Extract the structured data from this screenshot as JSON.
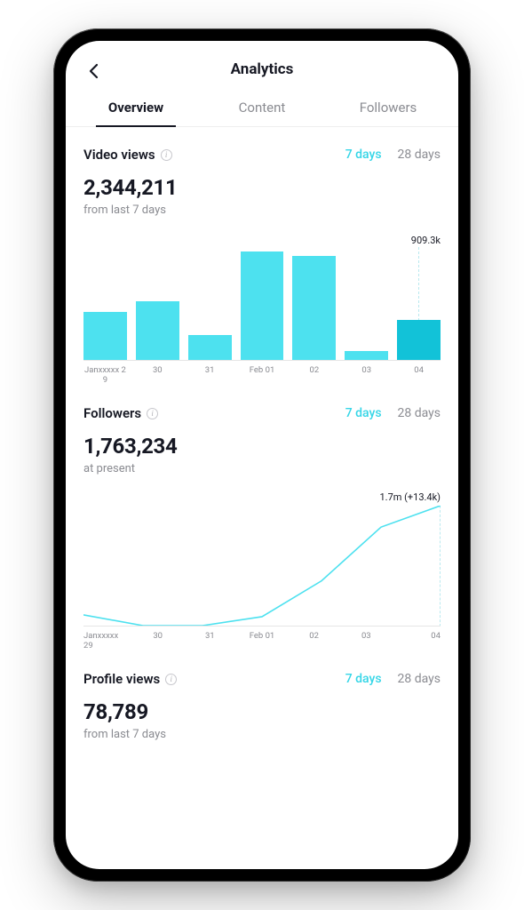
{
  "header": {
    "title": "Analytics"
  },
  "tabs": [
    {
      "label": "Overview",
      "active": true
    },
    {
      "label": "Content",
      "active": false
    },
    {
      "label": "Followers",
      "active": false
    }
  ],
  "range_options": {
    "seven": "7 days",
    "twenty_eight": "28 days"
  },
  "video_views": {
    "title": "Video views",
    "value": "2,344,211",
    "sub": "from last 7 days",
    "annotation": "909.3k"
  },
  "followers": {
    "title": "Followers",
    "value": "1,763,234",
    "sub": "at present",
    "annotation": "1.7m (+13.4k)"
  },
  "profile_views": {
    "title": "Profile views",
    "value": "78,789",
    "sub": "from last 7 days"
  },
  "chart_data": [
    {
      "type": "bar",
      "title": "Video views",
      "categories": [
        "Janxxxxx 29",
        "30",
        "31",
        "Feb 01",
        "02",
        "03",
        "04"
      ],
      "values": [
        390,
        470,
        200,
        875,
        840,
        70,
        320
      ],
      "ylim": [
        0,
        909.3
      ],
      "unit": "k",
      "annotation": "909.3k",
      "highlight_index": 6
    },
    {
      "type": "line",
      "title": "Followers",
      "categories": [
        "Janxxxxx 29",
        "30",
        "31",
        "Feb 01",
        "02",
        "03",
        "04"
      ],
      "values": [
        1.6878,
        1.6866,
        1.6866,
        1.6876,
        1.6916,
        1.6976,
        1.7
      ],
      "ylim": [
        1.6866,
        1.7
      ],
      "unit": "m",
      "annotation": "1.7m (+13.4k)"
    }
  ]
}
